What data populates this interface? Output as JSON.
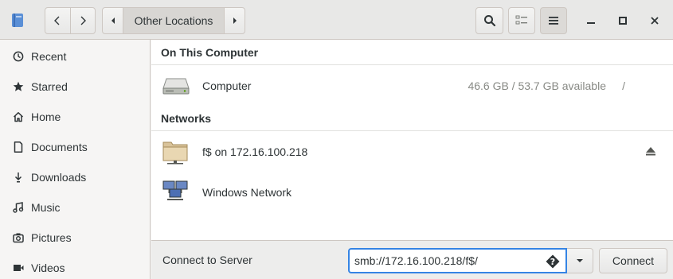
{
  "header": {
    "app_icon": "files-app-icon",
    "back_icon": "chevron-left-icon",
    "forward_icon": "chevron-right-icon",
    "path_left_icon": "arrow-left-icon",
    "path_right_icon": "arrow-right-icon",
    "location": "Other Locations",
    "search_icon": "search-icon",
    "view_icon": "list-view-icon",
    "menu_icon": "hamburger-menu-icon",
    "minimize_icon": "minimize-icon",
    "maximize_icon": "maximize-icon",
    "close_icon": "close-icon"
  },
  "sidebar": {
    "items": [
      {
        "label": "Recent",
        "icon": "clock-icon"
      },
      {
        "label": "Starred",
        "icon": "star-icon"
      },
      {
        "label": "Home",
        "icon": "home-icon"
      },
      {
        "label": "Documents",
        "icon": "document-icon"
      },
      {
        "label": "Downloads",
        "icon": "download-icon"
      },
      {
        "label": "Music",
        "icon": "music-icon"
      },
      {
        "label": "Pictures",
        "icon": "camera-icon"
      },
      {
        "label": "Videos",
        "icon": "video-icon"
      }
    ]
  },
  "main": {
    "section_computer": "On This Computer",
    "computer": {
      "name": "Computer",
      "info": "46.6 GB / 53.7 GB available",
      "path": "/",
      "icon": "hard-drive-icon"
    },
    "section_networks": "Networks",
    "share": {
      "name": "f$ on 172.16.100.218",
      "icon": "network-folder-icon",
      "action_icon": "eject-icon"
    },
    "windows_network": {
      "name": "Windows Network",
      "icon": "windows-network-icon"
    }
  },
  "connect": {
    "label": "Connect to Server",
    "server_value": "smb://172.16.100.218/f$/",
    "help_icon": "question-diamond-icon",
    "dropdown_icon": "caret-down-icon",
    "button_label": "Connect"
  },
  "colors": {
    "accent": "#3584e4",
    "header_bg": "#e8e8e7",
    "sidebar_bg": "#f6f5f4",
    "main_bg": "#ffffff",
    "text": "#2e3436",
    "muted_text": "#888a85"
  }
}
